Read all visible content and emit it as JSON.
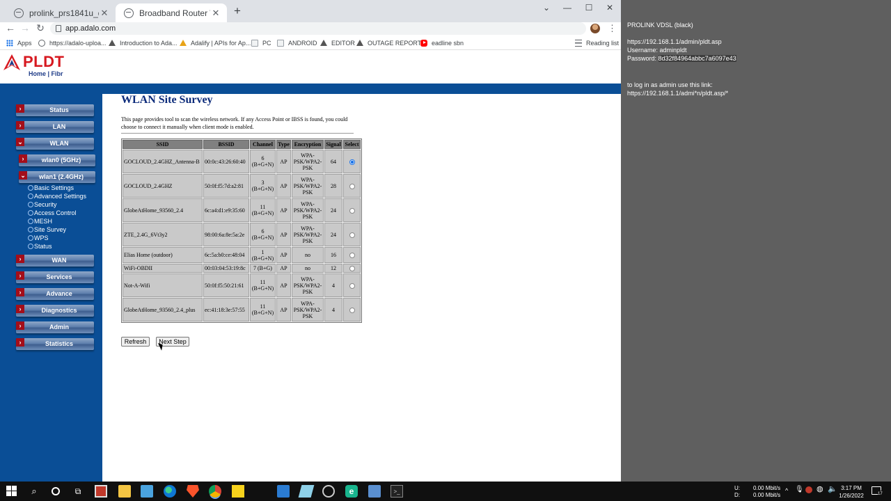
{
  "browser": {
    "tabs": [
      {
        "title": "prolink_prs1841u_dual_band_wif",
        "active": false
      },
      {
        "title": "Broadband Router Webserver",
        "active": true
      }
    ],
    "url": "app.adalo.com",
    "bookmarks": [
      {
        "label": "Apps",
        "icon": "apps-grid-icon"
      },
      {
        "label": "https://adalo-uploa...",
        "icon": "globe-icon"
      },
      {
        "label": "Introduction to Ada...",
        "icon": "adalo-icon"
      },
      {
        "label": "Adalify | APIs for Ap...",
        "icon": "adalify-icon"
      },
      {
        "label": "PC",
        "icon": "page-icon"
      },
      {
        "label": "ANDROID",
        "icon": "page-icon"
      },
      {
        "label": "EDITOR",
        "icon": "adalo-icon"
      },
      {
        "label": "OUTAGE REPORTS",
        "icon": "adalo-icon"
      },
      {
        "label": "eadline sbn",
        "icon": "youtube-icon"
      }
    ],
    "reading_list": "Reading list"
  },
  "router": {
    "brand": "PLDT",
    "brand_sub": "Home | Fibr",
    "menu": [
      {
        "label": "Status",
        "expanded": false
      },
      {
        "label": "LAN",
        "expanded": false
      },
      {
        "label": "WLAN",
        "expanded": true
      },
      {
        "label": "wlan0 (5GHz)",
        "expanded": false,
        "sub": true
      },
      {
        "label": "wlan1 (2.4GHz)",
        "expanded": true,
        "sub": true
      },
      {
        "label": "WAN",
        "expanded": false
      },
      {
        "label": "Services",
        "expanded": false
      },
      {
        "label": "Advance",
        "expanded": false
      },
      {
        "label": "Diagnostics",
        "expanded": false
      },
      {
        "label": "Admin",
        "expanded": false
      },
      {
        "label": "Statistics",
        "expanded": false
      }
    ],
    "submenu": [
      "Basic Settings",
      "Advanced Settings",
      "Security",
      "Access Control",
      "MESH",
      "Site Survey",
      "WPS",
      "Status"
    ],
    "title": "WLAN Site Survey",
    "description": "This page provides tool to scan the wireless network. If any Access Point or IBSS is found, you could choose to connect it manually when client mode is enabled.",
    "columns": [
      "SSID",
      "BSSID",
      "Channel",
      "Type",
      "Encryption",
      "Signal",
      "Select"
    ],
    "rows": [
      {
        "ssid": "GOCLOUD_2.4GHZ_Antenna-B",
        "bssid": "00:0c:43:26:60:40",
        "channel": "6 (B+G+N)",
        "type": "AP",
        "encryption": "WPA-PSK/WPA2-PSK",
        "signal": "64",
        "selected": true
      },
      {
        "ssid": "GOCLOUD_2.4GHZ",
        "bssid": "50:0f:f5:7d:a2:81",
        "channel": "3 (B+G+N)",
        "type": "AP",
        "encryption": "WPA-PSK/WPA2-PSK",
        "signal": "28",
        "selected": false
      },
      {
        "ssid": "GlobeAtHome_93560_2.4",
        "bssid": "6c:a4:d1:e9:35:60",
        "channel": "11 (B+G+N)",
        "type": "AP",
        "encryption": "WPA-PSK/WPA2-PSK",
        "signal": "24",
        "selected": false
      },
      {
        "ssid": "ZTE_2.4G_6Vt3y2",
        "bssid": "98:00:6a:8e:5a:2e",
        "channel": "6 (B+G+N)",
        "type": "AP",
        "encryption": "WPA-PSK/WPA2-PSK",
        "signal": "24",
        "selected": false
      },
      {
        "ssid": "Elias Home (outdoor)",
        "bssid": "6c:5a:b0:ce:48:04",
        "channel": "1 (B+G+N)",
        "type": "AP",
        "encryption": "no",
        "signal": "16",
        "selected": false
      },
      {
        "ssid": "WiFi-OBDII",
        "bssid": "00:03:04:53:19:8c",
        "channel": "7 (B+G)",
        "type": "AP",
        "encryption": "no",
        "signal": "12",
        "selected": false
      },
      {
        "ssid": "Not-A-Wifi",
        "bssid": "50:0f:f5:50:21:61",
        "channel": "11 (B+G+N)",
        "type": "AP",
        "encryption": "WPA-PSK/WPA2-PSK",
        "signal": "4",
        "selected": false
      },
      {
        "ssid": "GlobeAtHome_93560_2.4_plus",
        "bssid": "ec:41:18:3e:57:55",
        "channel": "11 (B+G+N)",
        "type": "AP",
        "encryption": "WPA-PSK/WPA2-PSK",
        "signal": "4",
        "selected": false
      }
    ],
    "refresh_label": "Refresh",
    "next_label": "Next Step"
  },
  "notes": {
    "heading": "PROLINK VDSL (black)",
    "url": "https://192.168.1.1/admin/pldt.asp",
    "username": "Username: adminpldt",
    "password_prefix": "Password: ",
    "password": "8d32f84964abbc7a6097e43",
    "hint": "to log in as admin use this link:",
    "hint_url": "https://192.168.1.1/admi*n/pldt.asp/*"
  },
  "taskbar": {
    "net_up_label": "U:",
    "net_down_label": "D:",
    "net_up": "0.00 Mbit/s",
    "net_down": "0.00 Mbit/s",
    "time": "3:17 PM",
    "date": "1/26/2022",
    "notification_count": "17"
  }
}
